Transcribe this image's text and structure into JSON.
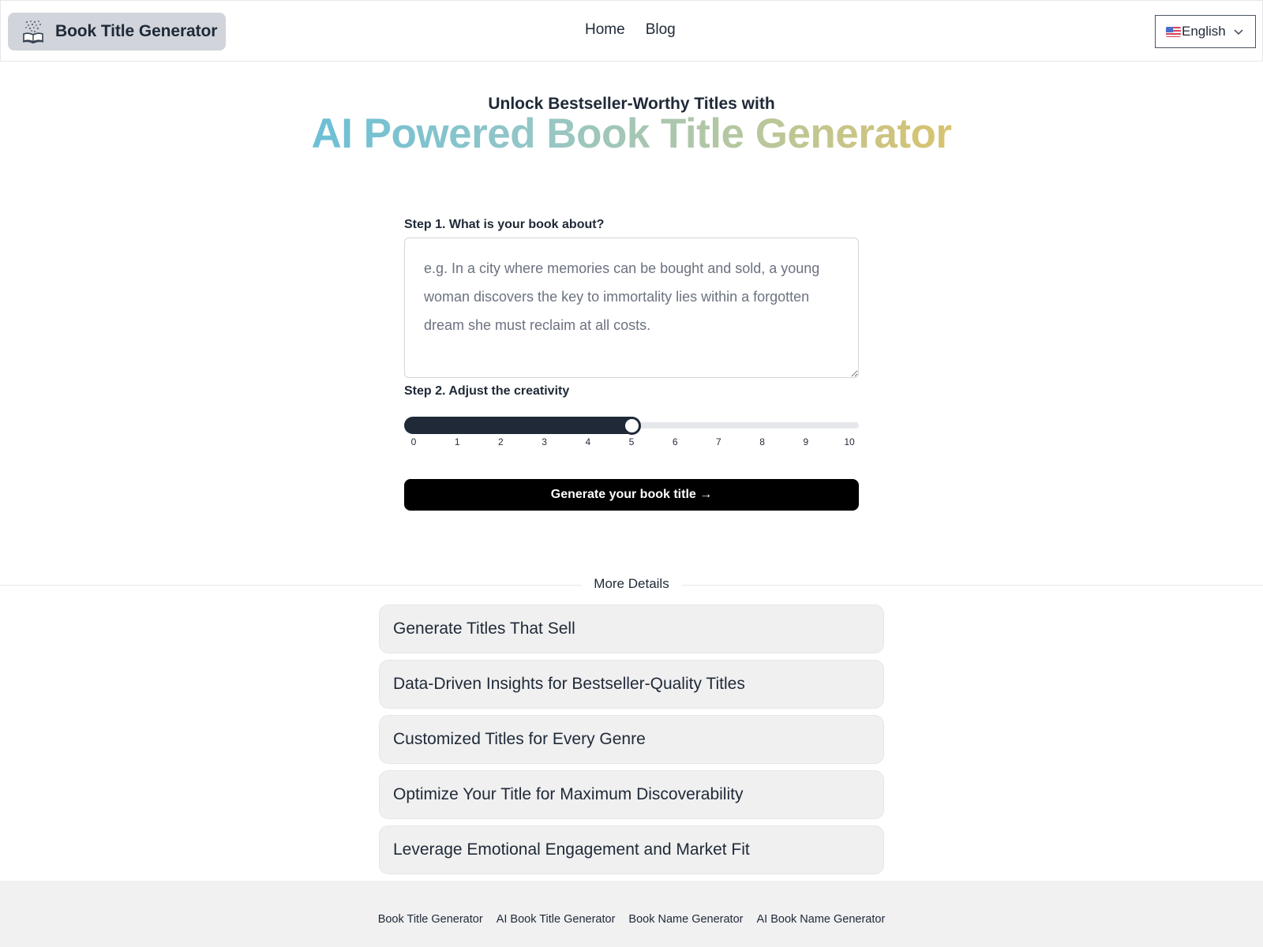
{
  "header": {
    "logo_label": "Book Title Generator",
    "logo_icon": "open-book-icon",
    "nav": [
      {
        "label": "Home"
      },
      {
        "label": "Blog"
      }
    ],
    "language": {
      "selected": "English",
      "flag_icon": "us-flag-icon",
      "dropdown_icon": "chevron-down-icon"
    }
  },
  "hero": {
    "subtitle": "Unlock Bestseller-Worthy Titles with",
    "title": "AI Powered Book Title Generator",
    "gradient_colors": [
      "#6cbfd6",
      "#95c6c6",
      "#b9c79c",
      "#d8c36f"
    ]
  },
  "form": {
    "step1_label": "Step 1. What is your book about?",
    "textarea_value": "",
    "textarea_placeholder": "e.g. In a city where memories can be bought and sold, a young woman discovers the key to immortality lies within a forgotten dream she must reclaim at all costs.",
    "step2_label": "Step 2. Adjust the creativity",
    "slider": {
      "min": 0,
      "max": 10,
      "value": 5,
      "ticks": [
        "0",
        "1",
        "2",
        "3",
        "4",
        "5",
        "6",
        "7",
        "8",
        "9",
        "10"
      ]
    },
    "generate_label": "Generate your book title →"
  },
  "details": {
    "divider_label": "More Details",
    "items": [
      {
        "label": "Generate Titles That Sell"
      },
      {
        "label": "Data-Driven Insights for Bestseller-Quality Titles"
      },
      {
        "label": "Customized Titles for Every Genre"
      },
      {
        "label": "Optimize Your Title for Maximum Discoverability"
      },
      {
        "label": "Leverage Emotional Engagement and Market Fit"
      }
    ]
  },
  "footer": {
    "links": [
      {
        "label": "Book Title Generator"
      },
      {
        "label": "AI Book Title Generator"
      },
      {
        "label": "Book Name Generator"
      },
      {
        "label": "AI Book Name Generator"
      }
    ]
  },
  "colors": {
    "text": "#1f2937",
    "button_bg": "#000000",
    "slider_fill": "#1f2937",
    "accordion_bg": "#f0f0f1",
    "footer_bg": "#f1f1f2",
    "logo_bg": "#d1d5db"
  }
}
